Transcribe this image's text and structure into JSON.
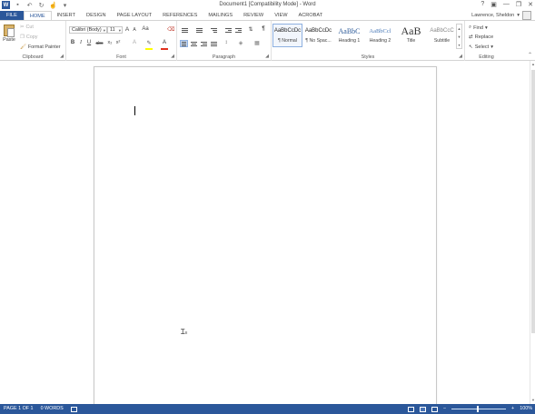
{
  "window": {
    "title": "Document1 [Compatibility Mode] - Word",
    "controls": [
      "?",
      "▣",
      "—",
      "❐",
      "✕"
    ]
  },
  "quick_access": [
    "save-icon",
    "undo-icon",
    "redo-icon",
    "touch-mode-icon",
    "customize-icon"
  ],
  "tabs": [
    {
      "label": "FILE"
    },
    {
      "label": "HOME"
    },
    {
      "label": "INSERT"
    },
    {
      "label": "DESIGN"
    },
    {
      "label": "PAGE LAYOUT"
    },
    {
      "label": "REFERENCES"
    },
    {
      "label": "MAILINGS"
    },
    {
      "label": "REVIEW"
    },
    {
      "label": "VIEW"
    },
    {
      "label": "ACROBAT"
    }
  ],
  "user": {
    "name": "Lawrence, Sheldon"
  },
  "clipboard": {
    "group_label": "Clipboard",
    "paste": "Paste",
    "cut": "Cut",
    "copy": "Copy",
    "format_painter": "Format Painter"
  },
  "font": {
    "group_label": "Font",
    "font_name": "Calibri (Body)",
    "font_size": "11",
    "grow": "A",
    "shrink": "A",
    "change_case": "Aa",
    "bold": "B",
    "italic": "I",
    "underline": "U",
    "strikethrough": "abc",
    "subscript": "x₂",
    "superscript": "x²",
    "text_effects": "A",
    "font_color": "A",
    "highlight_color": "#ffff00",
    "font_color_value": "#e0301e"
  },
  "paragraph": {
    "group_label": "Paragraph",
    "show_marks": "¶"
  },
  "styles": {
    "group_label": "Styles",
    "items": [
      {
        "sample": "AaBbCcDc",
        "name": "¶ Normal"
      },
      {
        "sample": "AaBbCcDc",
        "name": "¶ No Spac..."
      },
      {
        "sample": "AaBbC",
        "name": "Heading 1"
      },
      {
        "sample": "AaBbCcl",
        "name": "Heading 2"
      },
      {
        "sample": "AaB",
        "name": "Title"
      },
      {
        "sample": "AaBbCcC",
        "name": "Subtitle"
      }
    ]
  },
  "editing": {
    "group_label": "Editing",
    "find": "Find",
    "replace": "Replace",
    "select": "Select"
  },
  "status": {
    "page": "PAGE 1 OF 1",
    "words": "0 WORDS",
    "zoom": "100%"
  }
}
